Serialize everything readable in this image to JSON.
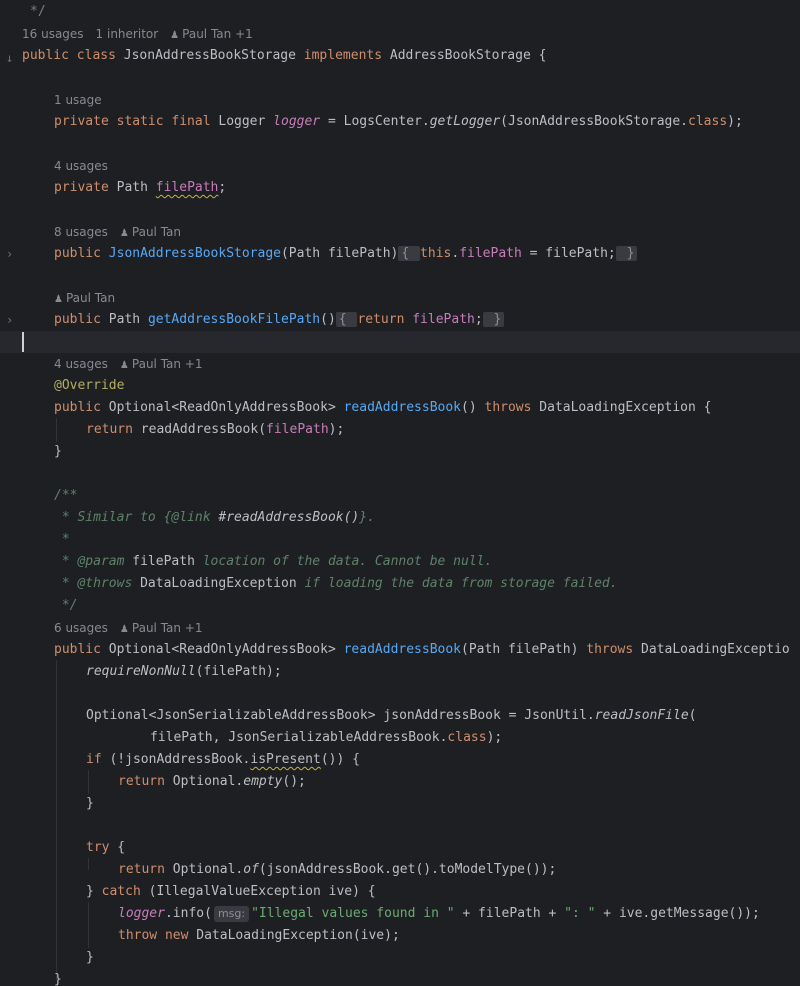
{
  "gutter": {
    "override_marker": "↓",
    "fold_marker": "›"
  },
  "hints": {
    "class_usages": "16 usages",
    "class_inheritors": "1 inheritor",
    "class_author": "Paul Tan +1",
    "logger_usages": "1 usage",
    "filepath_usages": "4 usages",
    "ctor_usages": "8 usages",
    "ctor_author": "Paul Tan",
    "getter_author": "Paul Tan",
    "read1_usages": "4 usages",
    "read1_author": "Paul Tan +1",
    "read2_usages": "6 usages",
    "read2_author": "Paul Tan +1",
    "msg_param": "msg:"
  },
  "code": {
    "comment_end": "*/",
    "class_decl": {
      "kw1": "public",
      "kw2": "class",
      "name": "JsonAddressBookStorage",
      "kw3": "implements",
      "iface": "AddressBookStorage",
      "brace": "{"
    },
    "logger": {
      "mods": "private static final",
      "type": "Logger",
      "name": "logger",
      "eq": "=",
      "cls": "LogsCenter.",
      "call": "getLogger",
      "arg": "(JsonAddressBookStorage.",
      "argkw": "class",
      "end": ");"
    },
    "field": {
      "mods": "private",
      "type": "Path",
      "name": "filePath",
      "semi": ";"
    },
    "ctor": {
      "mod": "public",
      "name": "JsonAddressBookStorage",
      "params": "(Path filePath)",
      "fold_open": "{",
      "this_kw": "this",
      "dot": ".",
      "fld": "filePath",
      "rest": " = filePath;",
      "fold_close": "}"
    },
    "getter": {
      "mod": "public",
      "type": "Path",
      "name": "getAddressBookFilePath",
      "parens": "()",
      "fold_open": "{",
      "ret": "return",
      "fld": "filePath",
      "semi": ";",
      "fold_close": "}"
    },
    "read1": {
      "annotation": "@Override",
      "mod": "public",
      "type": "Optional<ReadOnlyAddressBook>",
      "name": "readAddressBook",
      "parens": "()",
      "throws_kw": "throws",
      "exc": "DataLoadingException",
      "brace": "{",
      "body_ret": "return",
      "body_call": "readAddressBook(",
      "body_fld": "filePath",
      "body_end": ");",
      "close": "}"
    },
    "javadoc": {
      "open": "/**",
      "l1_pre": " * Similar to ",
      "l1_link_open": "{@link ",
      "l1_link_ref": "#readAddressBook()",
      "l1_link_close": "}.",
      "l2": " *",
      "l3_star": " * ",
      "l3_tag": "@param",
      "l3_val": "filePath",
      "l3_text": " location of the data. Cannot be null.",
      "l4_star": " * ",
      "l4_tag": "@throws",
      "l4_val": "DataLoadingException",
      "l4_text": " if loading the data from storage failed.",
      "close": " */"
    },
    "read2": {
      "mod": "public",
      "type": "Optional<ReadOnlyAddressBook>",
      "name": "readAddressBook",
      "params": "(Path filePath)",
      "throws_kw": "throws",
      "exc": "DataLoadingExceptio",
      "req_call": "requireNonNull",
      "req_arg": "(filePath);",
      "opt_decl": "Optional<JsonSerializableAddressBook> jsonAddressBook = JsonUtil.",
      "opt_call": "readJsonFile",
      "opt_paren": "(",
      "opt_args": "filePath, JsonSerializableAddressBook.",
      "opt_class_kw": "class",
      "opt_end": ");",
      "if_kw": "if",
      "if_cond1": " (!jsonAddressBook.",
      "if_cond2": "isPresent",
      "if_cond3": "()) {",
      "ret1_kw": "return",
      "ret1_a": " Optional.",
      "ret1_b": "empty",
      "ret1_c": "();",
      "close_if": "}",
      "try_kw": "try",
      "try_brace": " {",
      "ret2_kw": "return",
      "ret2_a": " Optional.",
      "ret2_b": "of",
      "ret2_c": "(jsonAddressBook.get().toModelType());",
      "catch_open": "} ",
      "catch_kw": "catch",
      "catch_rest": " (IllegalValueException ive) {",
      "log_fld": "logger",
      "log_call": ".info(",
      "log_str1": "\"Illegal values found in \"",
      "log_rest1": " + filePath + ",
      "log_str2": "\": \"",
      "log_rest2": " + ive.getMessage());",
      "throw_kw": "throw",
      "new_kw": "new",
      "throw_rest": " DataLoadingException(ive);",
      "close_catch": "}",
      "close_method": "}"
    }
  }
}
